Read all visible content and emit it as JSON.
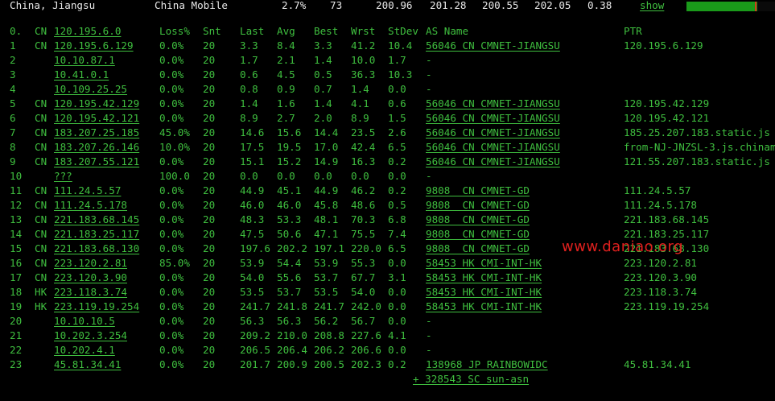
{
  "topbar": {
    "location": "China, Jiangsu",
    "isp": "China Mobile",
    "loss": "2.7%",
    "count": "73",
    "v1": "200.96",
    "v2": "201.28",
    "v3": "200.55",
    "v4": "202.05",
    "v5": "0.38",
    "show": "show",
    "bar_fill_fraction": 0.8,
    "bar_mark_fraction": 0.77,
    "colors": {
      "bar": "#1a9a1a",
      "mark": "#d43a1a"
    }
  },
  "headers": {
    "num": "0.",
    "cc": "CN",
    "host": "120.195.6.0",
    "loss": "Loss%",
    "snt": "Snt",
    "last": "Last",
    "avg": "Avg",
    "best": "Best",
    "wrst": "Wrst",
    "std": "StDev",
    "as": "AS Name",
    "ptr": "PTR"
  },
  "rows": [
    {
      "num": "1",
      "cc": "CN",
      "host": "120.195.6.129",
      "loss": "0.0%",
      "snt": "20",
      "last": "3.3",
      "avg": "8.4",
      "best": "3.3",
      "wrst": "41.2",
      "std": "10.4",
      "as": "56046 CN CMNET-JIANGSU",
      "ptr": "120.195.6.129"
    },
    {
      "num": "2",
      "cc": "",
      "host": "10.10.87.1",
      "loss": "0.0%",
      "snt": "20",
      "last": "1.7",
      "avg": "2.1",
      "best": "1.4",
      "wrst": "10.0",
      "std": "1.7",
      "as": "-",
      "ptr": ""
    },
    {
      "num": "3",
      "cc": "",
      "host": "10.41.0.1",
      "loss": "0.0%",
      "snt": "20",
      "last": "0.6",
      "avg": "4.5",
      "best": "0.5",
      "wrst": "36.3",
      "std": "10.3",
      "as": "-",
      "ptr": ""
    },
    {
      "num": "4",
      "cc": "",
      "host": "10.109.25.25",
      "loss": "0.0%",
      "snt": "20",
      "last": "0.8",
      "avg": "0.9",
      "best": "0.7",
      "wrst": "1.4",
      "std": "0.0",
      "as": "-",
      "ptr": ""
    },
    {
      "num": "5",
      "cc": "CN",
      "host": "120.195.42.129",
      "loss": "0.0%",
      "snt": "20",
      "last": "1.4",
      "avg": "1.6",
      "best": "1.4",
      "wrst": "4.1",
      "std": "0.6",
      "as": "56046 CN CMNET-JIANGSU",
      "ptr": "120.195.42.129"
    },
    {
      "num": "6",
      "cc": "CN",
      "host": "120.195.42.121",
      "loss": "0.0%",
      "snt": "20",
      "last": "8.9",
      "avg": "2.7",
      "best": "2.0",
      "wrst": "8.9",
      "std": "1.5",
      "as": "56046 CN CMNET-JIANGSU",
      "ptr": "120.195.42.121"
    },
    {
      "num": "7",
      "cc": "CN",
      "host": "183.207.25.185",
      "loss": "45.0%",
      "snt": "20",
      "last": "14.6",
      "avg": "15.6",
      "best": "14.4",
      "wrst": "23.5",
      "std": "2.6",
      "as": "56046 CN CMNET-JIANGSU",
      "ptr": "185.25.207.183.static.js"
    },
    {
      "num": "8",
      "cc": "CN",
      "host": "183.207.26.146",
      "loss": "10.0%",
      "snt": "20",
      "last": "17.5",
      "avg": "19.5",
      "best": "17.0",
      "wrst": "42.4",
      "std": "6.5",
      "as": "56046 CN CMNET-JIANGSU",
      "ptr": "from-NJ-JNZSL-3.js.chinam"
    },
    {
      "num": "9",
      "cc": "CN",
      "host": "183.207.55.121",
      "loss": "0.0%",
      "snt": "20",
      "last": "15.1",
      "avg": "15.2",
      "best": "14.9",
      "wrst": "16.3",
      "std": "0.2",
      "as": "56046 CN CMNET-JIANGSU",
      "ptr": "121.55.207.183.static.js"
    },
    {
      "num": "10",
      "cc": "",
      "host": "???",
      "loss": "100.0",
      "snt": "20",
      "last": "0.0",
      "avg": "0.0",
      "best": "0.0",
      "wrst": "0.0",
      "std": "0.0",
      "as": "-",
      "ptr": ""
    },
    {
      "num": "11",
      "cc": "CN",
      "host": "111.24.5.57",
      "loss": "0.0%",
      "snt": "20",
      "last": "44.9",
      "avg": "45.1",
      "best": "44.9",
      "wrst": "46.2",
      "std": "0.2",
      "as": "9808  CN CMNET-GD",
      "ptr": "111.24.5.57"
    },
    {
      "num": "12",
      "cc": "CN",
      "host": "111.24.5.178",
      "loss": "0.0%",
      "snt": "20",
      "last": "46.0",
      "avg": "46.0",
      "best": "45.8",
      "wrst": "48.6",
      "std": "0.5",
      "as": "9808  CN CMNET-GD",
      "ptr": "111.24.5.178"
    },
    {
      "num": "13",
      "cc": "CN",
      "host": "221.183.68.145",
      "loss": "0.0%",
      "snt": "20",
      "last": "48.3",
      "avg": "53.3",
      "best": "48.1",
      "wrst": "70.3",
      "std": "6.8",
      "as": "9808  CN CMNET-GD",
      "ptr": "221.183.68.145"
    },
    {
      "num": "14",
      "cc": "CN",
      "host": "221.183.25.117",
      "loss": "0.0%",
      "snt": "20",
      "last": "47.5",
      "avg": "50.6",
      "best": "47.1",
      "wrst": "75.5",
      "std": "7.4",
      "as": "9808  CN CMNET-GD",
      "ptr": "221.183.25.117"
    },
    {
      "num": "15",
      "cc": "CN",
      "host": "221.183.68.130",
      "loss": "0.0%",
      "snt": "20",
      "last": "197.6",
      "avg": "202.2",
      "best": "197.1",
      "wrst": "220.0",
      "std": "6.5",
      "as": "9808  CN CMNET-GD",
      "ptr": "221.183.68.130"
    },
    {
      "num": "16",
      "cc": "CN",
      "host": "223.120.2.81",
      "loss": "85.0%",
      "snt": "20",
      "last": "53.9",
      "avg": "54.4",
      "best": "53.9",
      "wrst": "55.3",
      "std": "0.0",
      "as": "58453 HK CMI-INT-HK",
      "ptr": "223.120.2.81"
    },
    {
      "num": "17",
      "cc": "CN",
      "host": "223.120.3.90",
      "loss": "0.0%",
      "snt": "20",
      "last": "54.0",
      "avg": "55.6",
      "best": "53.7",
      "wrst": "67.7",
      "std": "3.1",
      "as": "58453 HK CMI-INT-HK",
      "ptr": "223.120.3.90"
    },
    {
      "num": "18",
      "cc": "HK",
      "host": "223.118.3.74",
      "loss": "0.0%",
      "snt": "20",
      "last": "53.5",
      "avg": "53.7",
      "best": "53.5",
      "wrst": "54.0",
      "std": "0.0",
      "as": "58453 HK CMI-INT-HK",
      "ptr": "223.118.3.74"
    },
    {
      "num": "19",
      "cc": "HK",
      "host": "223.119.19.254",
      "loss": "0.0%",
      "snt": "20",
      "last": "241.7",
      "avg": "241.8",
      "best": "241.7",
      "wrst": "242.0",
      "std": "0.0",
      "as": "58453 HK CMI-INT-HK",
      "ptr": "223.119.19.254"
    },
    {
      "num": "20",
      "cc": "",
      "host": "10.10.10.5",
      "loss": "0.0%",
      "snt": "20",
      "last": "56.3",
      "avg": "56.3",
      "best": "56.2",
      "wrst": "56.7",
      "std": "0.0",
      "as": "-",
      "ptr": ""
    },
    {
      "num": "21",
      "cc": "",
      "host": "10.202.3.254",
      "loss": "0.0%",
      "snt": "20",
      "last": "209.2",
      "avg": "210.0",
      "best": "208.8",
      "wrst": "227.6",
      "std": "4.1",
      "as": "-",
      "ptr": ""
    },
    {
      "num": "22",
      "cc": "",
      "host": "10.202.4.1",
      "loss": "0.0%",
      "snt": "20",
      "last": "206.5",
      "avg": "206.4",
      "best": "206.2",
      "wrst": "206.6",
      "std": "0.0",
      "as": "-",
      "ptr": ""
    },
    {
      "num": "23",
      "cc": "",
      "host": "45.81.34.41",
      "loss": "0.0%",
      "snt": "20",
      "last": "201.7",
      "avg": "200.9",
      "best": "200.5",
      "wrst": "202.3",
      "std": "0.2",
      "as": "138968 JP RAINBOWIDC",
      "ptr": "45.81.34.41"
    }
  ],
  "extra_as": "+ 328543 SC sun-asn",
  "watermark": "www.daniao.org"
}
